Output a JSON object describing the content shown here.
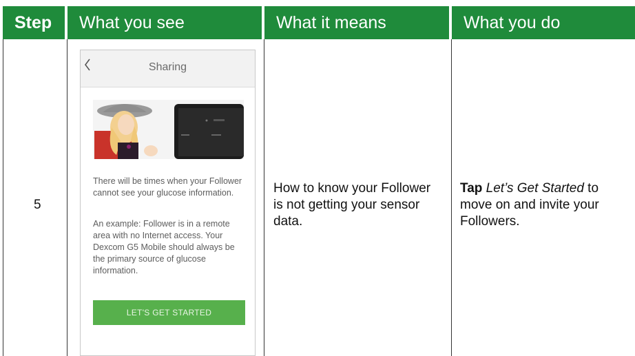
{
  "headers": {
    "step": "Step",
    "what_you_see": "What you see",
    "what_it_means": "What it means",
    "what_you_do": "What you do"
  },
  "row": {
    "step_number": "5",
    "means_text": "How to know your Follower is not getting your sensor data.",
    "do_bold": "Tap",
    "do_italic": "Let’s Get Started",
    "do_rest": " to move on and invite your Followers."
  },
  "phone": {
    "title": "Sharing",
    "back_icon": "chevron-left-icon",
    "paragraph1": "There will be times when your Follower cannot see your glucose information.",
    "paragraph2": "An example: Follower is in a remote area with no Internet access. Your Dexcom G5 Mobile should always be the primary source of glucose information.",
    "button_label": "LET'S GET STARTED"
  },
  "colors": {
    "header_green": "#1f8b3b",
    "button_green": "#57b04c"
  }
}
